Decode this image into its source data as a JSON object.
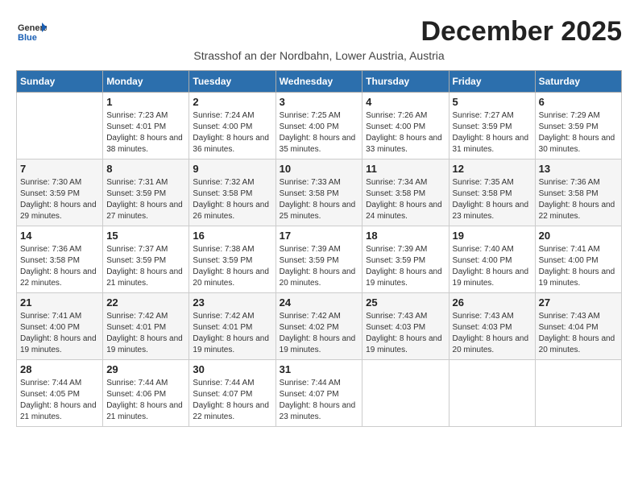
{
  "logo": {
    "general": "General",
    "blue": "Blue"
  },
  "header": {
    "month": "December 2025",
    "location": "Strasshof an der Nordbahn, Lower Austria, Austria"
  },
  "weekdays": [
    "Sunday",
    "Monday",
    "Tuesday",
    "Wednesday",
    "Thursday",
    "Friday",
    "Saturday"
  ],
  "weeks": [
    [
      {
        "day": "",
        "sunrise": "",
        "sunset": "",
        "daylight": ""
      },
      {
        "day": "1",
        "sunrise": "Sunrise: 7:23 AM",
        "sunset": "Sunset: 4:01 PM",
        "daylight": "Daylight: 8 hours and 38 minutes."
      },
      {
        "day": "2",
        "sunrise": "Sunrise: 7:24 AM",
        "sunset": "Sunset: 4:00 PM",
        "daylight": "Daylight: 8 hours and 36 minutes."
      },
      {
        "day": "3",
        "sunrise": "Sunrise: 7:25 AM",
        "sunset": "Sunset: 4:00 PM",
        "daylight": "Daylight: 8 hours and 35 minutes."
      },
      {
        "day": "4",
        "sunrise": "Sunrise: 7:26 AM",
        "sunset": "Sunset: 4:00 PM",
        "daylight": "Daylight: 8 hours and 33 minutes."
      },
      {
        "day": "5",
        "sunrise": "Sunrise: 7:27 AM",
        "sunset": "Sunset: 3:59 PM",
        "daylight": "Daylight: 8 hours and 31 minutes."
      },
      {
        "day": "6",
        "sunrise": "Sunrise: 7:29 AM",
        "sunset": "Sunset: 3:59 PM",
        "daylight": "Daylight: 8 hours and 30 minutes."
      }
    ],
    [
      {
        "day": "7",
        "sunrise": "Sunrise: 7:30 AM",
        "sunset": "Sunset: 3:59 PM",
        "daylight": "Daylight: 8 hours and 29 minutes."
      },
      {
        "day": "8",
        "sunrise": "Sunrise: 7:31 AM",
        "sunset": "Sunset: 3:59 PM",
        "daylight": "Daylight: 8 hours and 27 minutes."
      },
      {
        "day": "9",
        "sunrise": "Sunrise: 7:32 AM",
        "sunset": "Sunset: 3:58 PM",
        "daylight": "Daylight: 8 hours and 26 minutes."
      },
      {
        "day": "10",
        "sunrise": "Sunrise: 7:33 AM",
        "sunset": "Sunset: 3:58 PM",
        "daylight": "Daylight: 8 hours and 25 minutes."
      },
      {
        "day": "11",
        "sunrise": "Sunrise: 7:34 AM",
        "sunset": "Sunset: 3:58 PM",
        "daylight": "Daylight: 8 hours and 24 minutes."
      },
      {
        "day": "12",
        "sunrise": "Sunrise: 7:35 AM",
        "sunset": "Sunset: 3:58 PM",
        "daylight": "Daylight: 8 hours and 23 minutes."
      },
      {
        "day": "13",
        "sunrise": "Sunrise: 7:36 AM",
        "sunset": "Sunset: 3:58 PM",
        "daylight": "Daylight: 8 hours and 22 minutes."
      }
    ],
    [
      {
        "day": "14",
        "sunrise": "Sunrise: 7:36 AM",
        "sunset": "Sunset: 3:58 PM",
        "daylight": "Daylight: 8 hours and 22 minutes."
      },
      {
        "day": "15",
        "sunrise": "Sunrise: 7:37 AM",
        "sunset": "Sunset: 3:59 PM",
        "daylight": "Daylight: 8 hours and 21 minutes."
      },
      {
        "day": "16",
        "sunrise": "Sunrise: 7:38 AM",
        "sunset": "Sunset: 3:59 PM",
        "daylight": "Daylight: 8 hours and 20 minutes."
      },
      {
        "day": "17",
        "sunrise": "Sunrise: 7:39 AM",
        "sunset": "Sunset: 3:59 PM",
        "daylight": "Daylight: 8 hours and 20 minutes."
      },
      {
        "day": "18",
        "sunrise": "Sunrise: 7:39 AM",
        "sunset": "Sunset: 3:59 PM",
        "daylight": "Daylight: 8 hours and 19 minutes."
      },
      {
        "day": "19",
        "sunrise": "Sunrise: 7:40 AM",
        "sunset": "Sunset: 4:00 PM",
        "daylight": "Daylight: 8 hours and 19 minutes."
      },
      {
        "day": "20",
        "sunrise": "Sunrise: 7:41 AM",
        "sunset": "Sunset: 4:00 PM",
        "daylight": "Daylight: 8 hours and 19 minutes."
      }
    ],
    [
      {
        "day": "21",
        "sunrise": "Sunrise: 7:41 AM",
        "sunset": "Sunset: 4:00 PM",
        "daylight": "Daylight: 8 hours and 19 minutes."
      },
      {
        "day": "22",
        "sunrise": "Sunrise: 7:42 AM",
        "sunset": "Sunset: 4:01 PM",
        "daylight": "Daylight: 8 hours and 19 minutes."
      },
      {
        "day": "23",
        "sunrise": "Sunrise: 7:42 AM",
        "sunset": "Sunset: 4:01 PM",
        "daylight": "Daylight: 8 hours and 19 minutes."
      },
      {
        "day": "24",
        "sunrise": "Sunrise: 7:42 AM",
        "sunset": "Sunset: 4:02 PM",
        "daylight": "Daylight: 8 hours and 19 minutes."
      },
      {
        "day": "25",
        "sunrise": "Sunrise: 7:43 AM",
        "sunset": "Sunset: 4:03 PM",
        "daylight": "Daylight: 8 hours and 19 minutes."
      },
      {
        "day": "26",
        "sunrise": "Sunrise: 7:43 AM",
        "sunset": "Sunset: 4:03 PM",
        "daylight": "Daylight: 8 hours and 20 minutes."
      },
      {
        "day": "27",
        "sunrise": "Sunrise: 7:43 AM",
        "sunset": "Sunset: 4:04 PM",
        "daylight": "Daylight: 8 hours and 20 minutes."
      }
    ],
    [
      {
        "day": "28",
        "sunrise": "Sunrise: 7:44 AM",
        "sunset": "Sunset: 4:05 PM",
        "daylight": "Daylight: 8 hours and 21 minutes."
      },
      {
        "day": "29",
        "sunrise": "Sunrise: 7:44 AM",
        "sunset": "Sunset: 4:06 PM",
        "daylight": "Daylight: 8 hours and 21 minutes."
      },
      {
        "day": "30",
        "sunrise": "Sunrise: 7:44 AM",
        "sunset": "Sunset: 4:07 PM",
        "daylight": "Daylight: 8 hours and 22 minutes."
      },
      {
        "day": "31",
        "sunrise": "Sunrise: 7:44 AM",
        "sunset": "Sunset: 4:07 PM",
        "daylight": "Daylight: 8 hours and 23 minutes."
      },
      {
        "day": "",
        "sunrise": "",
        "sunset": "",
        "daylight": ""
      },
      {
        "day": "",
        "sunrise": "",
        "sunset": "",
        "daylight": ""
      },
      {
        "day": "",
        "sunrise": "",
        "sunset": "",
        "daylight": ""
      }
    ]
  ]
}
